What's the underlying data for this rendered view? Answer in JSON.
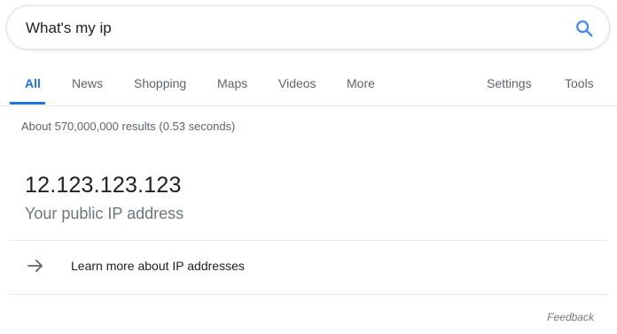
{
  "search": {
    "value": "What's my ip"
  },
  "tabs": [
    {
      "label": "All",
      "active": true
    },
    {
      "label": "News"
    },
    {
      "label": "Shopping"
    },
    {
      "label": "Maps"
    },
    {
      "label": "Videos"
    },
    {
      "label": "More"
    }
  ],
  "tools": [
    {
      "label": "Settings"
    },
    {
      "label": "Tools"
    }
  ],
  "result_stats": "About 570,000,000 results (0.53 seconds)",
  "ip_card": {
    "ip": "12.123.123.123",
    "caption": "Your public IP address",
    "learn_more": "Learn more about IP addresses"
  },
  "feedback": "Feedback",
  "colors": {
    "accent": "#1a73e8",
    "text_secondary": "#5f6368",
    "divider": "#ebebeb"
  },
  "icons": {
    "search": "search-icon",
    "arrow": "arrow-right-icon"
  }
}
